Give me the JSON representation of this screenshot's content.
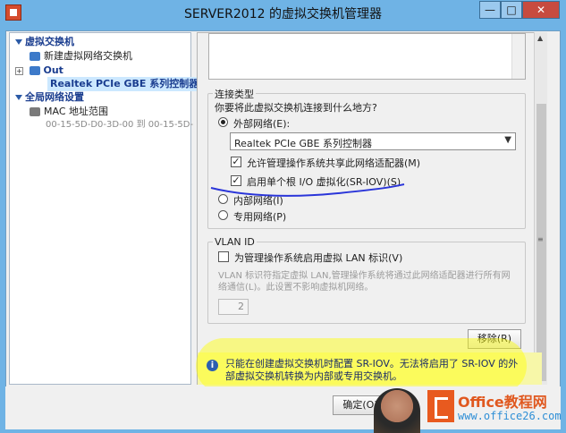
{
  "window": {
    "title": "SERVER2012 的虚拟交换机管理器"
  },
  "tree": {
    "virtual_switches": "虚拟交换机",
    "new_switch": "新建虚拟网络交换机",
    "out_name": "Out",
    "out_adapter": "Realtek PCIe GBE 系列控制器",
    "global_settings": "全局网络设置",
    "mac_range": "MAC 地址范围",
    "mac_value": "00-15-5D-D0-3D-00 到 00-15-5D-"
  },
  "connection": {
    "group_title": "连接类型",
    "question": "你要将此虚拟交换机连接到什么地方?",
    "external_label": "外部网络(E):",
    "adapter_selected": "Realtek PCIe GBE 系列控制器",
    "allow_share_label": "允许管理操作系统共享此网络适配器(M)",
    "sriov_label": "启用单个根 I/O 虚拟化(SR-IOV)(S)",
    "internal_label": "内部网络(I)",
    "private_label": "专用网络(P)"
  },
  "vlan": {
    "group_title": "VLAN ID",
    "enable_label": "为管理操作系统启用虚拟 LAN 标识(V)",
    "description": "VLAN 标识符指定虚拟 LAN,管理操作系统将通过此网络适配器进行所有网络通信(L)。此设置不影响虚拟机网络。",
    "value": "2"
  },
  "buttons": {
    "remove": "移除(R)",
    "ok": "确定(O)"
  },
  "info": {
    "text": "只能在创建虚拟交换机时配置 SR-IOV。无法将启用了 SR-IOV 的外部虚拟交换机转换为内部或专用交换机。"
  },
  "watermark": {
    "brand": "Office教程网",
    "url": "www.office26.com"
  },
  "icons": {
    "app": "hyper-v-icon",
    "info": "info-icon"
  },
  "colors": {
    "titlebar": "#6fb3e5",
    "accent": "#1a3d8f",
    "highlight": "#f7f7a8"
  }
}
